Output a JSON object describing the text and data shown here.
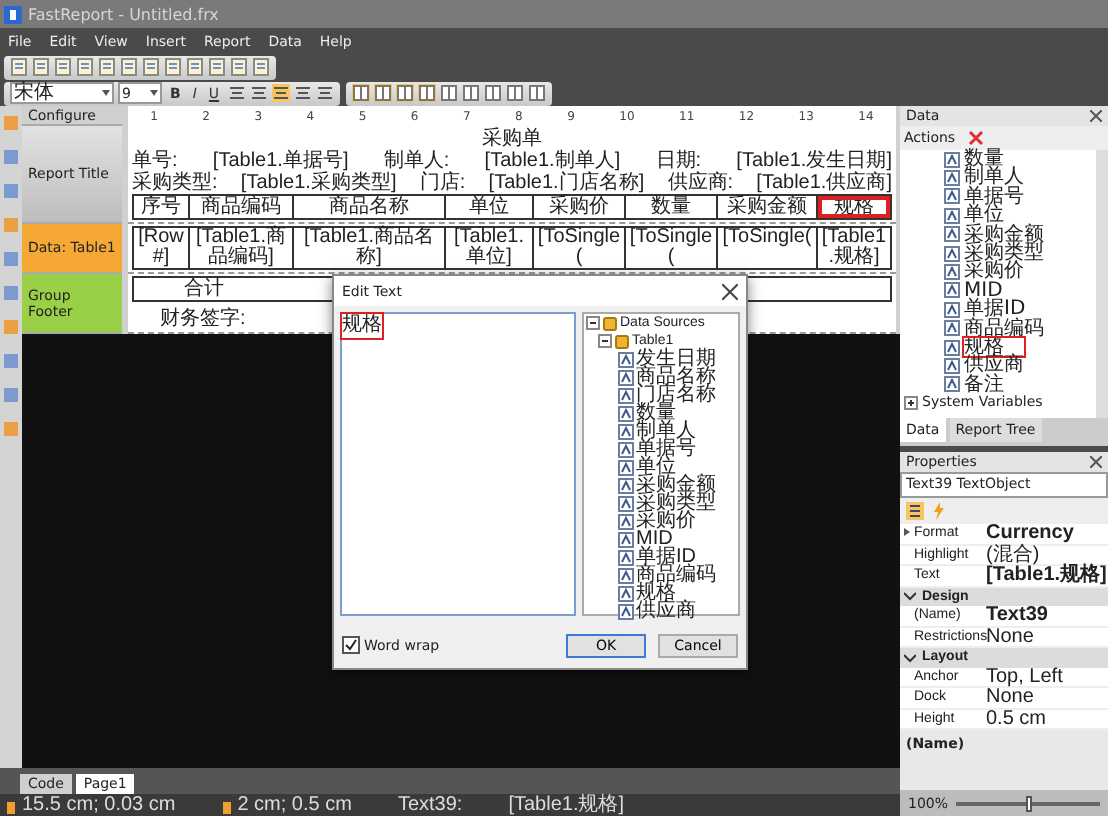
{
  "window": {
    "title": "FastReport - Untitled.frx"
  },
  "menu": [
    "File",
    "Edit",
    "View",
    "Insert",
    "Report",
    "Data",
    "Help"
  ],
  "format_toolbar": {
    "font": "宋体",
    "size": "9",
    "buttons": [
      "B",
      "I",
      "U"
    ]
  },
  "bands": [
    {
      "kind": "header",
      "label": "Configure"
    },
    {
      "kind": "title",
      "label": "Report Title"
    },
    {
      "kind": "data",
      "label": "Data: Table1"
    },
    {
      "kind": "footer",
      "label": "Group Footer"
    }
  ],
  "ruler": [
    "1",
    "2",
    "3",
    "4",
    "5",
    "6",
    "7",
    "8",
    "9",
    "10",
    "11",
    "12",
    "13",
    "14"
  ],
  "report": {
    "title": "采购单",
    "info_rows": [
      [
        "单号:",
        "[Table1.单据号]",
        "制单人:",
        "[Table1.制单人]",
        "日期:",
        "[Table1.发生日期]"
      ],
      [
        "采购类型:",
        "[Table1.采购类型]",
        "门店:",
        "[Table1.门店名称]",
        "供应商:",
        "[Table1.供应商]"
      ]
    ],
    "columns": [
      {
        "label": "序号",
        "selected": false
      },
      {
        "label": "商品编码",
        "selected": false
      },
      {
        "label": "商品名称",
        "selected": false
      },
      {
        "label": "单位",
        "selected": false
      },
      {
        "label": "采购价",
        "selected": false
      },
      {
        "label": "数量",
        "selected": false
      },
      {
        "label": "采购金额",
        "selected": false
      },
      {
        "label": "规格",
        "selected": true
      }
    ],
    "data_row": [
      "[Row#]",
      "[Table1.商品编码]",
      "[Table1.商品名称]",
      "[Table1.单位]",
      "[ToSingle(",
      "[ToSingle(",
      "[ToSingle(",
      "[Table1.规格]"
    ],
    "footer": {
      "total": "合计",
      "signature": "财务签字:"
    }
  },
  "edit_dialog": {
    "title": "Edit Text",
    "text": "规格",
    "text_highlighted": true,
    "tree": [
      {
        "label": "Data Sources",
        "expanded": true,
        "children": [
          {
            "label": "Table1",
            "expanded": true,
            "children": [
              {
                "label": "发生日期"
              },
              {
                "label": "商品名称"
              },
              {
                "label": "门店名称"
              },
              {
                "label": "数量"
              },
              {
                "label": "制单人"
              },
              {
                "label": "单据号"
              },
              {
                "label": "单位"
              },
              {
                "label": "采购金额"
              },
              {
                "label": "采购类型"
              },
              {
                "label": "采购价"
              },
              {
                "label": "MID"
              },
              {
                "label": "单据ID"
              },
              {
                "label": "商品编码"
              },
              {
                "label": "规格"
              },
              {
                "label": "供应商"
              }
            ]
          }
        ]
      }
    ],
    "word_wrap": {
      "label": "Word wrap",
      "checked": true
    },
    "buttons": [
      {
        "label": "OK",
        "default": true
      },
      {
        "label": "Cancel",
        "default": false
      }
    ]
  },
  "data_panel": {
    "title": "Data",
    "actions": "Actions",
    "items": [
      {
        "label": "数量",
        "selected": false
      },
      {
        "label": "制单人",
        "selected": false
      },
      {
        "label": "单据号",
        "selected": false
      },
      {
        "label": "单位",
        "selected": false
      },
      {
        "label": "采购金额",
        "selected": false
      },
      {
        "label": "采购类型",
        "selected": false
      },
      {
        "label": "采购价",
        "selected": false
      },
      {
        "label": "MID",
        "selected": false
      },
      {
        "label": "单据ID",
        "selected": false
      },
      {
        "label": "商品编码",
        "selected": false
      },
      {
        "label": "规格",
        "selected": true
      },
      {
        "label": "供应商",
        "selected": false
      },
      {
        "label": "备注",
        "selected": false
      }
    ],
    "system_variables": {
      "label": "System Variables",
      "expanded": false
    },
    "tabs": [
      {
        "label": "Data",
        "selected": true
      },
      {
        "label": "Report Tree",
        "selected": false
      }
    ]
  },
  "properties": {
    "title": "Properties",
    "object": "Text39 TextObject",
    "rows": [
      {
        "kind": "row",
        "name": "Format",
        "value": "Currency",
        "modified": true,
        "expandable": true
      },
      {
        "kind": "row",
        "name": "Highlight",
        "value": "(混合)",
        "modified": false,
        "expandable": false
      },
      {
        "kind": "row",
        "name": "Text",
        "value": "[Table1.规格]",
        "modified": true,
        "expandable": false
      },
      {
        "kind": "category",
        "name": "Design",
        "expanded": true
      },
      {
        "kind": "row",
        "name": "(Name)",
        "value": "Text39",
        "modified": true,
        "expandable": false
      },
      {
        "kind": "row",
        "name": "Restrictions",
        "value": "None",
        "modified": false,
        "expandable": false
      },
      {
        "kind": "category",
        "name": "Layout",
        "expanded": true
      },
      {
        "kind": "row",
        "name": "Anchor",
        "value": "Top, Left",
        "modified": false,
        "expandable": false
      },
      {
        "kind": "row",
        "name": "Dock",
        "value": "None",
        "modified": false,
        "expandable": false
      },
      {
        "kind": "row",
        "name": "Height",
        "value": "0.5 cm",
        "modified": false,
        "expandable": false
      }
    ],
    "description": "(Name)",
    "zoom": {
      "label": "100%",
      "level": 0.5
    }
  },
  "page_tabs": [
    {
      "label": "Code",
      "selected": false
    },
    {
      "label": "Page1",
      "selected": true
    }
  ],
  "status_bar": [
    "15.5 cm; 0.03 cm",
    "2 cm; 0.5 cm",
    "Text39:",
    "[Table1.规格]"
  ]
}
